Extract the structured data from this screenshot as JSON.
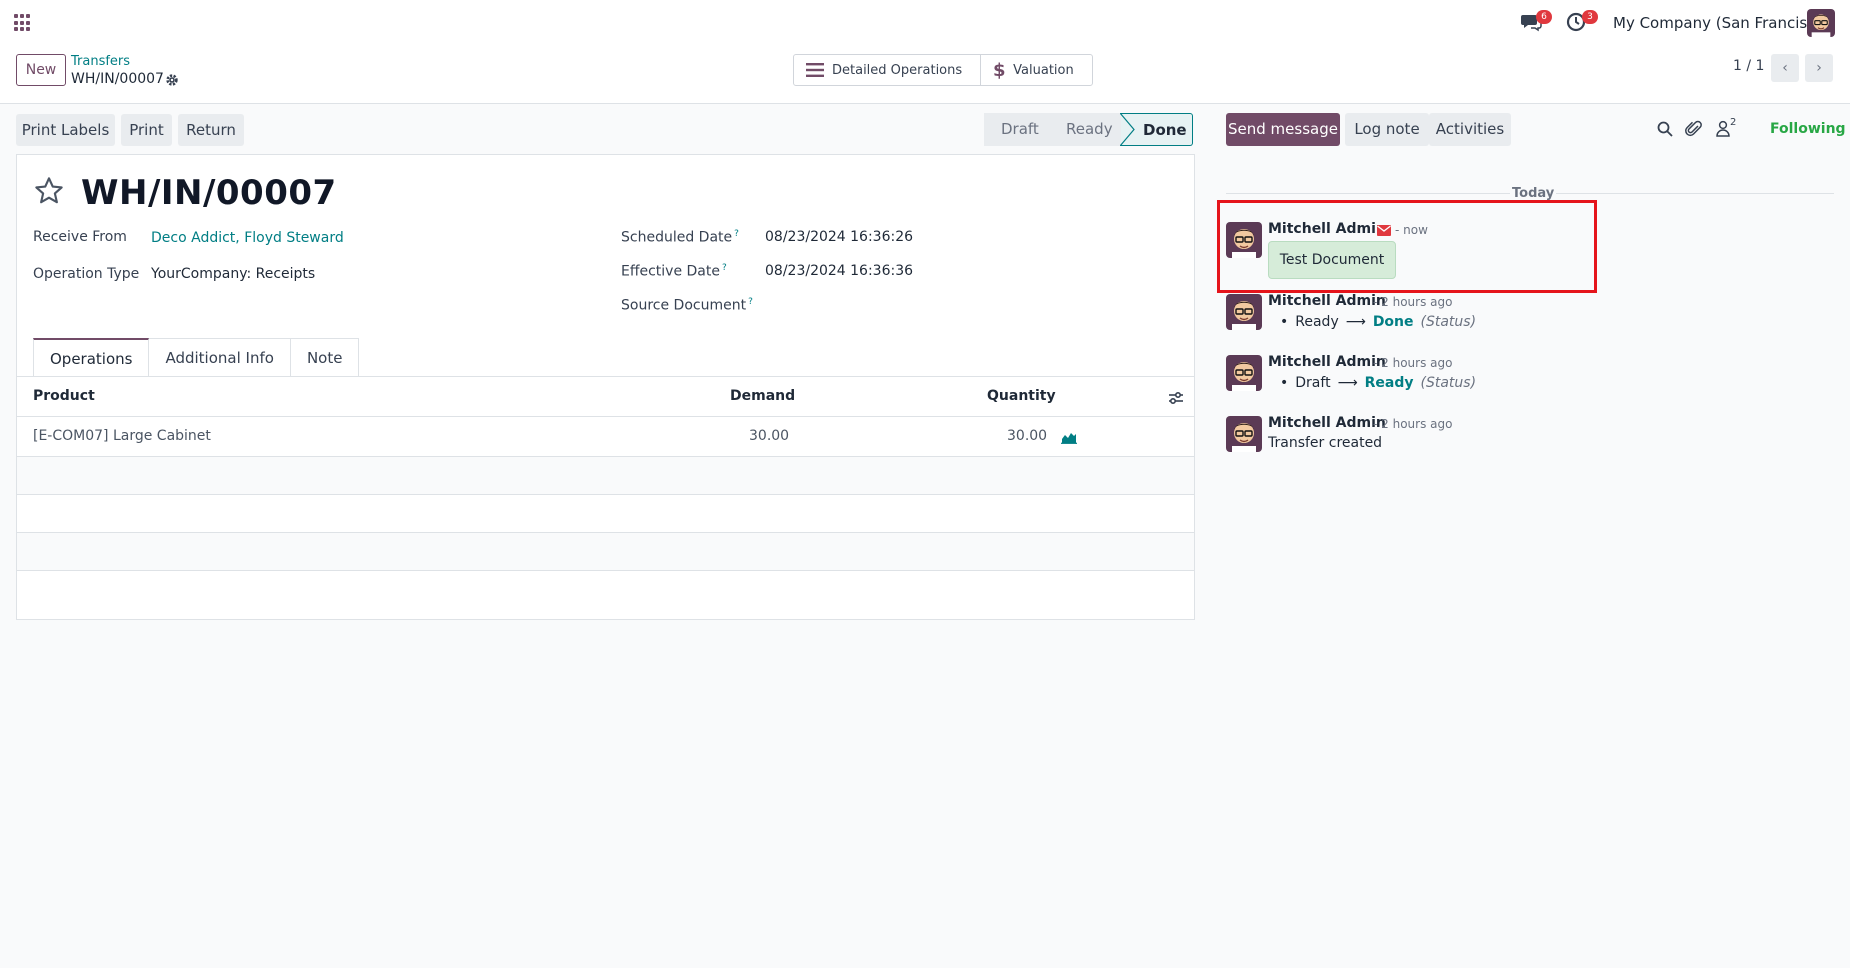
{
  "navbar": {
    "apps_icon": "apps-grid-icon",
    "messages_badge": "6",
    "activities_badge": "3",
    "company": "My Company (San Francisco)"
  },
  "control_panel": {
    "new_label": "New",
    "breadcrumb_parent": "Transfers",
    "breadcrumb_current": "WH/IN/00007",
    "smart_buttons": [
      "Detailed Operations",
      "Valuation"
    ],
    "pager": "1 / 1"
  },
  "actions": {
    "print_labels": "Print Labels",
    "print": "Print",
    "return": "Return"
  },
  "statusbar": {
    "stages": [
      "Draft",
      "Ready",
      "Done"
    ],
    "current": "Done"
  },
  "form": {
    "title": "WH/IN/00007",
    "receive_from_label": "Receive From",
    "receive_from_value": "Deco Addict, Floyd Steward",
    "operation_type_label": "Operation Type",
    "operation_type_value": "YourCompany: Receipts",
    "scheduled_date_label": "Scheduled Date",
    "scheduled_date_value": "08/23/2024 16:36:26",
    "effective_date_label": "Effective Date",
    "effective_date_value": "08/23/2024 16:36:36",
    "source_document_label": "Source Document",
    "help_mark": "?",
    "tabs": [
      "Operations",
      "Additional Info",
      "Note"
    ],
    "table": {
      "columns": [
        "Product",
        "Demand",
        "Quantity"
      ],
      "rows": [
        {
          "product": "[E-COM07] Large Cabinet",
          "demand": "30.00",
          "quantity": "30.00"
        }
      ]
    }
  },
  "chatter": {
    "send_message": "Send message",
    "log_note": "Log note",
    "activities": "Activities",
    "followers_count": "2",
    "following": "Following",
    "date_separator": "Today",
    "messages": [
      {
        "author": "Mitchell Admin",
        "time": "- now",
        "body": "Test Document"
      },
      {
        "author": "Mitchell Admin",
        "time": "- 2 hours ago",
        "old": "Ready",
        "new": "Done",
        "field": "(Status)"
      },
      {
        "author": "Mitchell Admin",
        "time": "- 2 hours ago",
        "old": "Draft",
        "new": "Ready",
        "field": "(Status)"
      },
      {
        "author": "Mitchell Admin",
        "time": "- 2 hours ago",
        "body": "Transfer created"
      }
    ]
  },
  "colors": {
    "brand": "#714b67",
    "link": "#017e84",
    "badge": "#e0383e",
    "following": "#28a745",
    "highlight": "#e5141b"
  }
}
